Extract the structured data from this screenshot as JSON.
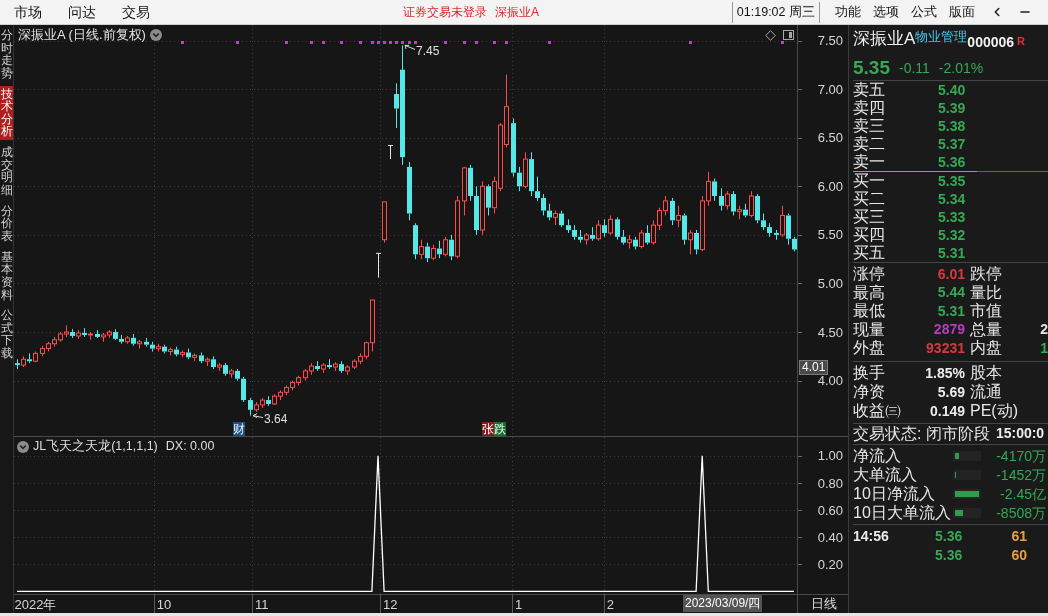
{
  "menu_bar": {
    "left_menu": [
      "市场",
      "问达",
      "交易"
    ],
    "login_status": "证券交易未登录",
    "security": "深振业A",
    "clock": "01:19:02 周三",
    "right_menu": [
      "功能",
      "选项",
      "公式",
      "版面"
    ]
  },
  "side_tabs": [
    {
      "label": "分时走势",
      "selected": false
    },
    {
      "label": "技术分析",
      "selected": true
    },
    {
      "label": "成交明细",
      "selected": false
    },
    {
      "label": "分价表",
      "selected": false
    },
    {
      "label": "基本资料",
      "selected": false
    },
    {
      "label": "公式下载",
      "selected": false
    }
  ],
  "price_pane": {
    "title": "深振业A (日线.前复权)",
    "high_label": "7.45",
    "low_label": "3.64",
    "cursor_price": "4.01",
    "badges": [
      {
        "text": "财",
        "kind": "info"
      },
      {
        "text": "张",
        "kind": "up"
      },
      {
        "text": "跌",
        "kind": "down"
      }
    ],
    "chart_data": [
      {
        "type": "candlestick",
        "ylim": [
          3.42,
          7.66
        ],
        "yticks": [
          {
            "value": 4,
            "label": "4.00"
          },
          {
            "value": 4.5,
            "label": "4.50"
          },
          {
            "value": 5,
            "label": "5.00"
          },
          {
            "value": 5.5,
            "label": "5.50"
          },
          {
            "value": 6,
            "label": "6.00"
          },
          {
            "value": 6.5,
            "label": "6.50"
          },
          {
            "value": 7,
            "label": "7.00"
          },
          {
            "value": 7.5,
            "label": "7.50"
          }
        ],
        "tick_labels": "y",
        "grid": true,
        "ohlc": [
          [
            4.18,
            4.22,
            4.12,
            4.16
          ],
          [
            4.16,
            4.25,
            4.14,
            4.22
          ],
          [
            4.22,
            4.28,
            4.18,
            4.2
          ],
          [
            4.2,
            4.3,
            4.19,
            4.28
          ],
          [
            4.28,
            4.36,
            4.25,
            4.33
          ],
          [
            4.33,
            4.4,
            4.3,
            4.38
          ],
          [
            4.38,
            4.45,
            4.35,
            4.42
          ],
          [
            4.42,
            4.5,
            4.4,
            4.48
          ],
          [
            4.48,
            4.57,
            4.45,
            4.5
          ],
          [
            4.5,
            4.53,
            4.44,
            4.46
          ],
          [
            4.46,
            4.52,
            4.43,
            4.49
          ],
          [
            4.49,
            4.54,
            4.45,
            4.47
          ],
          [
            4.47,
            4.5,
            4.42,
            4.48
          ],
          [
            4.48,
            4.52,
            4.44,
            4.45
          ],
          [
            4.45,
            4.49,
            4.4,
            4.47
          ],
          [
            4.47,
            4.52,
            4.44,
            4.5
          ],
          [
            4.5,
            4.53,
            4.42,
            4.43
          ],
          [
            4.43,
            4.47,
            4.38,
            4.4
          ],
          [
            4.4,
            4.46,
            4.38,
            4.44
          ],
          [
            4.44,
            4.48,
            4.36,
            4.38
          ],
          [
            4.38,
            4.42,
            4.33,
            4.4
          ],
          [
            4.4,
            4.44,
            4.35,
            4.37
          ],
          [
            4.37,
            4.4,
            4.3,
            4.33
          ],
          [
            4.33,
            4.38,
            4.3,
            4.35
          ],
          [
            4.35,
            4.37,
            4.28,
            4.3
          ],
          [
            4.3,
            4.34,
            4.26,
            4.32
          ],
          [
            4.32,
            4.35,
            4.25,
            4.27
          ],
          [
            4.27,
            4.31,
            4.24,
            4.29
          ],
          [
            4.29,
            4.33,
            4.22,
            4.24
          ],
          [
            4.24,
            4.28,
            4.2,
            4.26
          ],
          [
            4.26,
            4.29,
            4.18,
            4.2
          ],
          [
            4.2,
            4.24,
            4.15,
            4.22
          ],
          [
            4.22,
            4.25,
            4.12,
            4.14
          ],
          [
            4.14,
            4.18,
            4.1,
            4.16
          ],
          [
            4.16,
            4.18,
            4.05,
            4.07
          ],
          [
            4.07,
            4.12,
            4.03,
            4.1
          ],
          [
            4.1,
            4.12,
            4,
            4.02
          ],
          [
            4.02,
            4.04,
            3.78,
            3.8
          ],
          [
            3.8,
            3.82,
            3.64,
            3.7
          ],
          [
            3.7,
            3.78,
            3.68,
            3.75
          ],
          [
            3.75,
            3.82,
            3.72,
            3.8
          ],
          [
            3.8,
            3.84,
            3.74,
            3.76
          ],
          [
            3.76,
            3.86,
            3.75,
            3.84
          ],
          [
            3.84,
            3.9,
            3.8,
            3.88
          ],
          [
            3.88,
            3.95,
            3.85,
            3.93
          ],
          [
            3.93,
            4,
            3.9,
            3.98
          ],
          [
            3.98,
            4.05,
            3.95,
            4.03
          ],
          [
            4.03,
            4.12,
            4,
            4.1
          ],
          [
            4.1,
            4.18,
            4.06,
            4.15
          ],
          [
            4.15,
            4.2,
            4.1,
            4.12
          ],
          [
            4.12,
            4.18,
            4.08,
            4.16
          ],
          [
            4.16,
            4.22,
            4.12,
            4.14
          ],
          [
            4.14,
            4.19,
            4.1,
            4.17
          ],
          [
            4.17,
            4.2,
            4.08,
            4.1
          ],
          [
            4.1,
            4.16,
            4.06,
            4.14
          ],
          [
            4.14,
            4.22,
            4.12,
            4.2
          ],
          [
            4.2,
            4.28,
            4.17,
            4.25
          ],
          [
            4.25,
            4.4,
            4.22,
            4.39
          ],
          [
            4.39,
            4.83,
            4.3,
            4.83
          ],
          [
            5.31,
            5.31,
            5.06,
            5.31
          ],
          [
            5.45,
            5.84,
            5.42,
            5.84
          ],
          [
            6.42,
            6.42,
            6.28,
            6.42
          ],
          [
            6.95,
            7.06,
            6.6,
            6.8
          ],
          [
            7.2,
            7.45,
            6.22,
            6.3
          ],
          [
            6.2,
            6.25,
            5.65,
            5.72
          ],
          [
            5.6,
            5.62,
            5.25,
            5.3
          ],
          [
            5.3,
            5.45,
            5.25,
            5.38
          ],
          [
            5.38,
            5.42,
            5.22,
            5.26
          ],
          [
            5.26,
            5.4,
            5.24,
            5.36
          ],
          [
            5.36,
            5.44,
            5.26,
            5.3
          ],
          [
            5.3,
            5.48,
            5.28,
            5.45
          ],
          [
            5.45,
            5.5,
            5.24,
            5.28
          ],
          [
            5.28,
            5.9,
            5.26,
            5.85
          ],
          [
            5.85,
            6.2,
            5.7,
            6.19
          ],
          [
            6.19,
            6.22,
            5.85,
            5.9
          ],
          [
            5.9,
            6,
            5.5,
            5.55
          ],
          [
            5.55,
            6.05,
            5.5,
            6
          ],
          [
            6,
            6.02,
            5.7,
            5.78
          ],
          [
            5.78,
            6.1,
            5.72,
            6.05
          ],
          [
            5.98,
            6.65,
            5.95,
            6.63
          ],
          [
            6.43,
            7.15,
            6.4,
            6.82
          ],
          [
            6.65,
            6.7,
            6.1,
            6.14
          ],
          [
            6.14,
            6.2,
            5.95,
            6
          ],
          [
            6,
            6.35,
            5.98,
            6.28
          ],
          [
            6.28,
            6.35,
            5.9,
            5.95
          ],
          [
            5.95,
            6.1,
            5.85,
            5.88
          ],
          [
            5.88,
            5.92,
            5.7,
            5.75
          ],
          [
            5.75,
            5.82,
            5.65,
            5.68
          ],
          [
            5.68,
            5.75,
            5.6,
            5.72
          ],
          [
            5.72,
            5.75,
            5.58,
            5.6
          ],
          [
            5.6,
            5.66,
            5.52,
            5.55
          ],
          [
            5.55,
            5.6,
            5.45,
            5.48
          ],
          [
            5.48,
            5.55,
            5.42,
            5.45
          ],
          [
            5.45,
            5.52,
            5.4,
            5.5
          ],
          [
            5.5,
            5.58,
            5.44,
            5.46
          ],
          [
            5.46,
            5.65,
            5.44,
            5.6
          ],
          [
            5.6,
            5.66,
            5.48,
            5.52
          ],
          [
            5.52,
            5.7,
            5.5,
            5.66
          ],
          [
            5.66,
            5.68,
            5.45,
            5.48
          ],
          [
            5.48,
            5.55,
            5.4,
            5.42
          ],
          [
            5.42,
            5.5,
            5.36,
            5.45
          ],
          [
            5.45,
            5.48,
            5.35,
            5.38
          ],
          [
            5.38,
            5.55,
            5.36,
            5.52
          ],
          [
            5.52,
            5.6,
            5.4,
            5.42
          ],
          [
            5.42,
            5.65,
            5.4,
            5.6
          ],
          [
            5.6,
            5.78,
            5.55,
            5.75
          ],
          [
            5.75,
            5.9,
            5.7,
            5.85
          ],
          [
            5.85,
            5.88,
            5.6,
            5.65
          ],
          [
            5.65,
            5.8,
            5.58,
            5.7
          ],
          [
            5.7,
            5.72,
            5.4,
            5.45
          ],
          [
            5.45,
            5.55,
            5.3,
            5.52
          ],
          [
            5.52,
            5.55,
            5.3,
            5.35
          ],
          [
            5.35,
            5.9,
            5.33,
            5.85
          ],
          [
            5.85,
            6.15,
            5.8,
            6.05
          ],
          [
            6.05,
            6.08,
            5.85,
            5.9
          ],
          [
            5.9,
            5.98,
            5.75,
            5.8
          ],
          [
            5.8,
            5.95,
            5.76,
            5.92
          ],
          [
            5.92,
            5.95,
            5.7,
            5.74
          ],
          [
            5.74,
            5.8,
            5.66,
            5.76
          ],
          [
            5.76,
            5.82,
            5.68,
            5.7
          ],
          [
            5.7,
            5.95,
            5.68,
            5.9
          ],
          [
            5.9,
            5.92,
            5.62,
            5.65
          ],
          [
            5.65,
            5.72,
            5.55,
            5.58
          ],
          [
            5.58,
            5.62,
            5.48,
            5.52
          ],
          [
            5.52,
            5.55,
            5.45,
            5.5
          ],
          [
            5.5,
            5.8,
            5.48,
            5.7
          ],
          [
            5.7,
            5.72,
            5.4,
            5.46
          ],
          [
            5.46,
            5.48,
            5.33,
            5.35
          ]
        ],
        "series": [
          {
            "type": "scatter",
            "marker": "square",
            "color": "#c23cc8",
            "values": [
              null,
              null,
              null,
              null,
              null,
              null,
              null,
              null,
              null,
              null,
              null,
              null,
              null,
              null,
              null,
              null,
              null,
              null,
              null,
              null,
              null,
              null,
              null,
              null,
              null,
              null,
              null,
              7.48,
              null,
              null,
              null,
              null,
              null,
              null,
              null,
              null,
              7.48,
              null,
              null,
              null,
              null,
              null,
              null,
              null,
              7.48,
              null,
              null,
              null,
              7.48,
              null,
              7.48,
              null,
              null,
              7.48,
              null,
              null,
              7.48,
              null,
              7.48,
              7.48,
              7.48,
              7.48,
              7.48,
              7.48,
              7.48,
              7.48,
              null,
              null,
              null,
              null,
              7.48,
              null,
              null,
              7.48,
              null,
              7.48,
              null,
              null,
              7.48,
              null,
              7.48,
              null,
              null,
              null,
              null,
              null,
              null,
              7.48,
              null,
              null,
              null,
              null,
              null,
              null,
              null,
              null,
              null,
              null,
              null,
              null,
              null,
              null,
              null,
              null,
              null,
              null,
              null,
              null,
              null,
              null,
              7.48,
              null,
              null,
              null,
              null,
              null,
              null,
              null,
              null,
              null,
              null,
              null,
              null,
              null,
              null,
              7.48
            ]
          }
        ]
      }
    ]
  },
  "indicator_pane": {
    "title": "JL飞天之天龙(1,1,1,1)",
    "reading": "DX: 0.00",
    "cursor_date": "2023/03/09/四",
    "period": "日线",
    "chart_data": [
      {
        "type": "line",
        "ylim": [
          -0.02,
          1.14
        ],
        "yticks": [
          {
            "value": 0.2,
            "label": "0.20"
          },
          {
            "value": 0.4,
            "label": "0.40"
          },
          {
            "value": 0.6,
            "label": "0.60"
          },
          {
            "value": 0.8,
            "label": "0.80"
          },
          {
            "value": 1,
            "label": "1.00"
          }
        ],
        "grid": true,
        "color": "#ffffff",
        "categories": [
          null,
          null,
          null,
          "2022年",
          null,
          null,
          null,
          null,
          null,
          null,
          null,
          null,
          null,
          null,
          null,
          null,
          null,
          null,
          null,
          null,
          null,
          null,
          null,
          null,
          "10",
          null,
          null,
          null,
          null,
          null,
          null,
          null,
          null,
          null,
          null,
          null,
          null,
          null,
          null,
          null,
          "11",
          null,
          null,
          null,
          null,
          null,
          null,
          null,
          null,
          null,
          null,
          null,
          null,
          null,
          null,
          null,
          null,
          null,
          null,
          null,
          null,
          "12",
          null,
          null,
          null,
          null,
          null,
          null,
          null,
          null,
          null,
          null,
          null,
          null,
          null,
          null,
          null,
          null,
          null,
          null,
          null,
          null,
          "1",
          null,
          null,
          null,
          null,
          null,
          null,
          null,
          null,
          null,
          null,
          null,
          null,
          null,
          null,
          "2",
          null,
          null,
          null,
          null,
          null,
          null,
          null,
          null,
          null,
          null,
          null,
          null,
          null,
          null,
          null,
          null,
          null,
          null,
          null,
          null,
          null,
          null,
          null,
          null,
          null,
          null,
          null,
          null,
          null,
          null
        ],
        "values": [
          0,
          0,
          0,
          0,
          0,
          0,
          0,
          0,
          0,
          0,
          0,
          0,
          0,
          0,
          0,
          0,
          0,
          0,
          0,
          0,
          0,
          0,
          0,
          0,
          0,
          0,
          0,
          0,
          0,
          0,
          0,
          0,
          0,
          0,
          0,
          0,
          0,
          0,
          0,
          0,
          0,
          0,
          0,
          0,
          0,
          0,
          0,
          0,
          0,
          0,
          0,
          0,
          0,
          0,
          0,
          0,
          0,
          0,
          0,
          1,
          0,
          0,
          0,
          0,
          0,
          0,
          0,
          0,
          0,
          0,
          0,
          0,
          0,
          0,
          0,
          0,
          0,
          0,
          0,
          0,
          0,
          0,
          0,
          0,
          0,
          0,
          0,
          0,
          0,
          0,
          0,
          0,
          0,
          0,
          0,
          0,
          0,
          0,
          0,
          0,
          0,
          0,
          0,
          0,
          0,
          0,
          0,
          0,
          0,
          0,
          0,
          0,
          1,
          0,
          0,
          0,
          0,
          0,
          0,
          0,
          0,
          0,
          0,
          0,
          0,
          0,
          0,
          0
        ]
      }
    ]
  },
  "quote_panel": {
    "name": "深振业A",
    "industry": "物业管理",
    "code": "000006",
    "flag": "R",
    "price": "5.35",
    "change": "-0.11",
    "change_pct": "-2.01%",
    "asks": [
      {
        "label": "卖五",
        "price": "5.40"
      },
      {
        "label": "卖四",
        "price": "5.39"
      },
      {
        "label": "卖三",
        "price": "5.38"
      },
      {
        "label": "卖二",
        "price": "5.37"
      },
      {
        "label": "卖一",
        "price": "5.36"
      }
    ],
    "bids": [
      {
        "label": "买一",
        "price": "5.35"
      },
      {
        "label": "买二",
        "price": "5.34"
      },
      {
        "label": "买三",
        "price": "5.33"
      },
      {
        "label": "买四",
        "price": "5.32"
      },
      {
        "label": "买五",
        "price": "5.31"
      }
    ],
    "stats": [
      {
        "label": "涨停",
        "value": "6.01",
        "color": "#d8393f"
      },
      {
        "label": "跌停"
      },
      {
        "label": "最高",
        "value": "5.44",
        "color": "#36a856"
      },
      {
        "label": "量比"
      },
      {
        "label": "最低",
        "value": "5.31",
        "color": "#36a856"
      },
      {
        "label": "市值"
      },
      {
        "label": "现量",
        "value": "2879",
        "color": "#b83cbc"
      },
      {
        "label": "总量",
        "value": "2",
        "color": "#e6e6e6"
      },
      {
        "label": "外盘",
        "value": "93231",
        "color": "#d8393f"
      },
      {
        "label": "内盘",
        "value": "1",
        "color": "#36a856"
      }
    ],
    "fundamentals": [
      {
        "label": "换手",
        "value": "1.85%"
      },
      {
        "label": "股本"
      },
      {
        "label": "净资",
        "value": "5.69"
      },
      {
        "label": "流通"
      },
      {
        "label": "收益㈢",
        "value": "0.149"
      },
      {
        "label": "PE(动)"
      }
    ],
    "trading_state": {
      "label": "交易状态: 闭市阶段",
      "time": "15:00:0"
    },
    "fund_flows": [
      {
        "label": "净流入",
        "level": 0.17,
        "value": "-4170万"
      },
      {
        "label": "大单流入",
        "level": 0.06,
        "value": "-1452万"
      },
      {
        "label": "10日净流入",
        "level": 1,
        "value": "-2.45亿"
      },
      {
        "label": "10日大单流入",
        "level": 0.35,
        "value": "-8508万"
      }
    ],
    "ticks": [
      {
        "time": "14:56",
        "price": "5.36",
        "volume": "61"
      },
      {
        "price": "5.36",
        "volume": "60"
      }
    ]
  }
}
